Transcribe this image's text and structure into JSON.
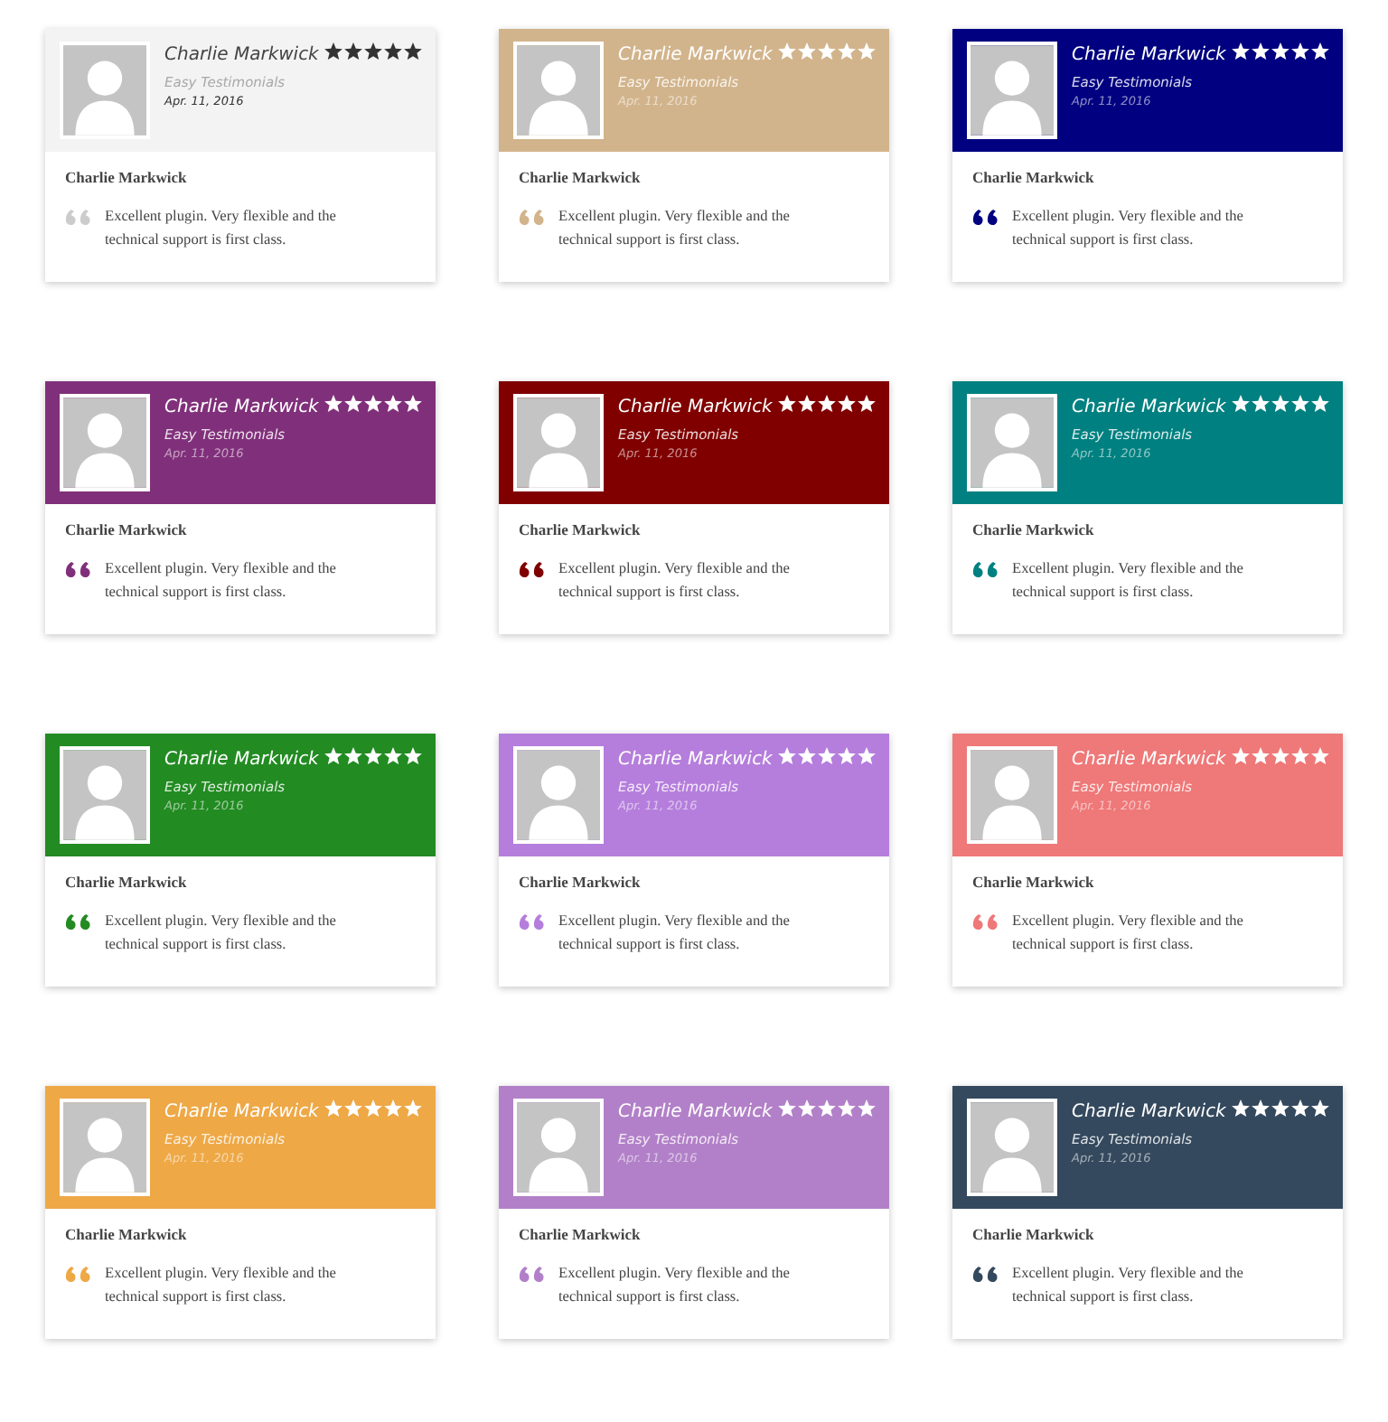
{
  "testimonials": [
    {
      "kind": "light",
      "color": "#f3f3f3",
      "name": "Charlie Markwick",
      "source": "Easy Testimonials",
      "date": "Apr. 11, 2016",
      "stars": 5,
      "author": "Charlie Markwick",
      "quote": "Excellent plugin. Very flexible and the technical support is first class."
    },
    {
      "kind": "dark",
      "color": "#d2b48c",
      "name": "Charlie Markwick",
      "source": "Easy Testimonials",
      "date": "Apr. 11, 2016",
      "stars": 5,
      "author": "Charlie Markwick",
      "quote": "Excellent plugin. Very flexible and the technical support is first class."
    },
    {
      "kind": "dark",
      "color": "#000080",
      "name": "Charlie Markwick",
      "source": "Easy Testimonials",
      "date": "Apr. 11, 2016",
      "stars": 5,
      "author": "Charlie Markwick",
      "quote": "Excellent plugin. Very flexible and the technical support is first class."
    },
    {
      "kind": "dark",
      "color": "#80307a",
      "name": "Charlie Markwick",
      "source": "Easy Testimonials",
      "date": "Apr. 11, 2016",
      "stars": 5,
      "author": "Charlie Markwick",
      "quote": "Excellent plugin. Very flexible and the technical support is first class."
    },
    {
      "kind": "dark",
      "color": "#800000",
      "name": "Charlie Markwick",
      "source": "Easy Testimonials",
      "date": "Apr. 11, 2016",
      "stars": 5,
      "author": "Charlie Markwick",
      "quote": "Excellent plugin. Very flexible and the technical support is first class."
    },
    {
      "kind": "dark",
      "color": "#008080",
      "name": "Charlie Markwick",
      "source": "Easy Testimonials",
      "date": "Apr. 11, 2016",
      "stars": 5,
      "author": "Charlie Markwick",
      "quote": "Excellent plugin. Very flexible and the technical support is first class."
    },
    {
      "kind": "dark",
      "color": "#228b22",
      "name": "Charlie Markwick",
      "source": "Easy Testimonials",
      "date": "Apr. 11, 2016",
      "stars": 5,
      "author": "Charlie Markwick",
      "quote": "Excellent plugin. Very flexible and the technical support is first class."
    },
    {
      "kind": "dark",
      "color": "#b57edc",
      "name": "Charlie Markwick",
      "source": "Easy Testimonials",
      "date": "Apr. 11, 2016",
      "stars": 5,
      "author": "Charlie Markwick",
      "quote": "Excellent plugin. Very flexible and the technical support is first class."
    },
    {
      "kind": "dark",
      "color": "#ef7878",
      "name": "Charlie Markwick",
      "source": "Easy Testimonials",
      "date": "Apr. 11, 2016",
      "stars": 5,
      "author": "Charlie Markwick",
      "quote": "Excellent plugin. Very flexible and the technical support is first class."
    },
    {
      "kind": "dark",
      "color": "#eea846",
      "name": "Charlie Markwick",
      "source": "Easy Testimonials",
      "date": "Apr. 11, 2016",
      "stars": 5,
      "author": "Charlie Markwick",
      "quote": "Excellent plugin. Very flexible and the technical support is first class."
    },
    {
      "kind": "dark",
      "color": "#b280c8",
      "name": "Charlie Markwick",
      "source": "Easy Testimonials",
      "date": "Apr. 11, 2016",
      "stars": 5,
      "author": "Charlie Markwick",
      "quote": "Excellent plugin. Very flexible and the technical support is first class."
    },
    {
      "kind": "dark",
      "color": "#34495e",
      "name": "Charlie Markwick",
      "source": "Easy Testimonials",
      "date": "Apr. 11, 2016",
      "stars": 5,
      "author": "Charlie Markwick",
      "quote": "Excellent plugin. Very flexible and the technical support is first class."
    }
  ]
}
